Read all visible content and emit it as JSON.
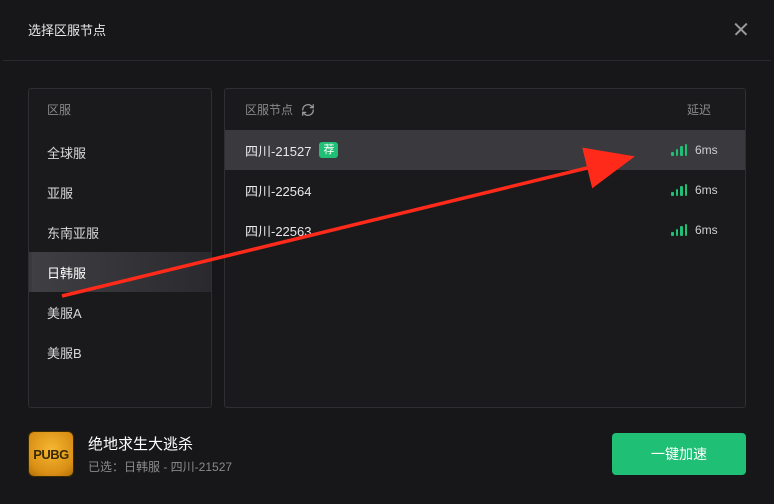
{
  "header": {
    "title": "选择区服节点",
    "close_icon": "close-icon"
  },
  "sidebar": {
    "heading": "区服",
    "items": [
      {
        "label": "全球服"
      },
      {
        "label": "亚服"
      },
      {
        "label": "东南亚服"
      },
      {
        "label": "日韩服"
      },
      {
        "label": "美服A"
      },
      {
        "label": "美服B"
      }
    ],
    "selected_index": 3
  },
  "content": {
    "heading_left": "区服节点",
    "heading_right": "延迟",
    "refresh_icon": "refresh-icon",
    "nodes": [
      {
        "name": "四川-21527",
        "recommended": true,
        "latency": "6ms"
      },
      {
        "name": "四川-22564",
        "recommended": false,
        "latency": "6ms"
      },
      {
        "name": "四川-22563",
        "recommended": false,
        "latency": "6ms"
      }
    ],
    "selected_node_index": 0,
    "recommended_badge_text": "荐"
  },
  "footer": {
    "game_icon_text": "PUBG",
    "game_title": "绝地求生大逃杀",
    "game_subtitle_prefix": "已选：",
    "game_subtitle_value": "日韩服 - 四川-21527",
    "boost_button_label": "一键加速"
  },
  "annotation": {
    "arrow_color": "#ff2a1a"
  }
}
